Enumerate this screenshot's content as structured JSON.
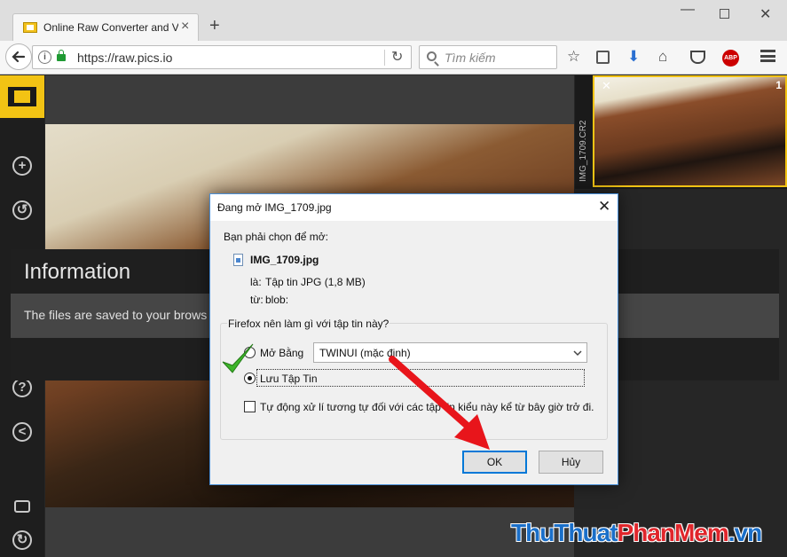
{
  "browser": {
    "tab_title": "Online Raw Converter and V",
    "tab_close": "×",
    "new_tab": "+",
    "url": "https://raw.pics.io",
    "search_placeholder": "Tìm kiếm",
    "abp_label": "ABP",
    "window_controls": {
      "minimize": "—",
      "close": "✕"
    }
  },
  "sidebar": {
    "icons": [
      "film-icon",
      "add-icon",
      "rotate-icon",
      "help-icon",
      "share-icon",
      "wallet-icon",
      "refresh-icon"
    ]
  },
  "info_panel": {
    "title": "Information",
    "message": "The files are saved to your brows"
  },
  "filmstrip": {
    "file_name": "IMG_1709.CR2",
    "index": "1",
    "close": "✕"
  },
  "dialog": {
    "title": "Đang mở IMG_1709.jpg",
    "close": "✕",
    "prompt": "Bạn phải chọn để mở:",
    "file_name": "IMG_1709.jpg",
    "type_label": "là:",
    "type_value": "Tập tin JPG (1,8 MB)",
    "from_label": "từ:",
    "from_value": "blob:",
    "group_label": "Firefox nên làm gì với tập tin này?",
    "open_with_label": "Mở Bằng",
    "open_with_value": "TWINUI (mặc định)",
    "save_file_label": "Lưu Tập Tin",
    "auto_label": "Tự động xử lí tương tự đối với các tập tin kiểu này kể từ bây giờ trở đi.",
    "ok_label": "OK",
    "cancel_label": "Hủy",
    "selected_option": "save_file"
  },
  "watermark": {
    "part1": "ThuThuat",
    "part2": "PhanMem",
    "part3": ".vn"
  },
  "colors": {
    "accent_yellow": "#f2c314",
    "dialog_border": "#4a90d9",
    "ok_border": "#0078d7",
    "arrow_red": "#e8151b",
    "check_green": "#3db52a",
    "watermark_blue": "#1a6fc9",
    "watermark_red": "#e0262b"
  }
}
